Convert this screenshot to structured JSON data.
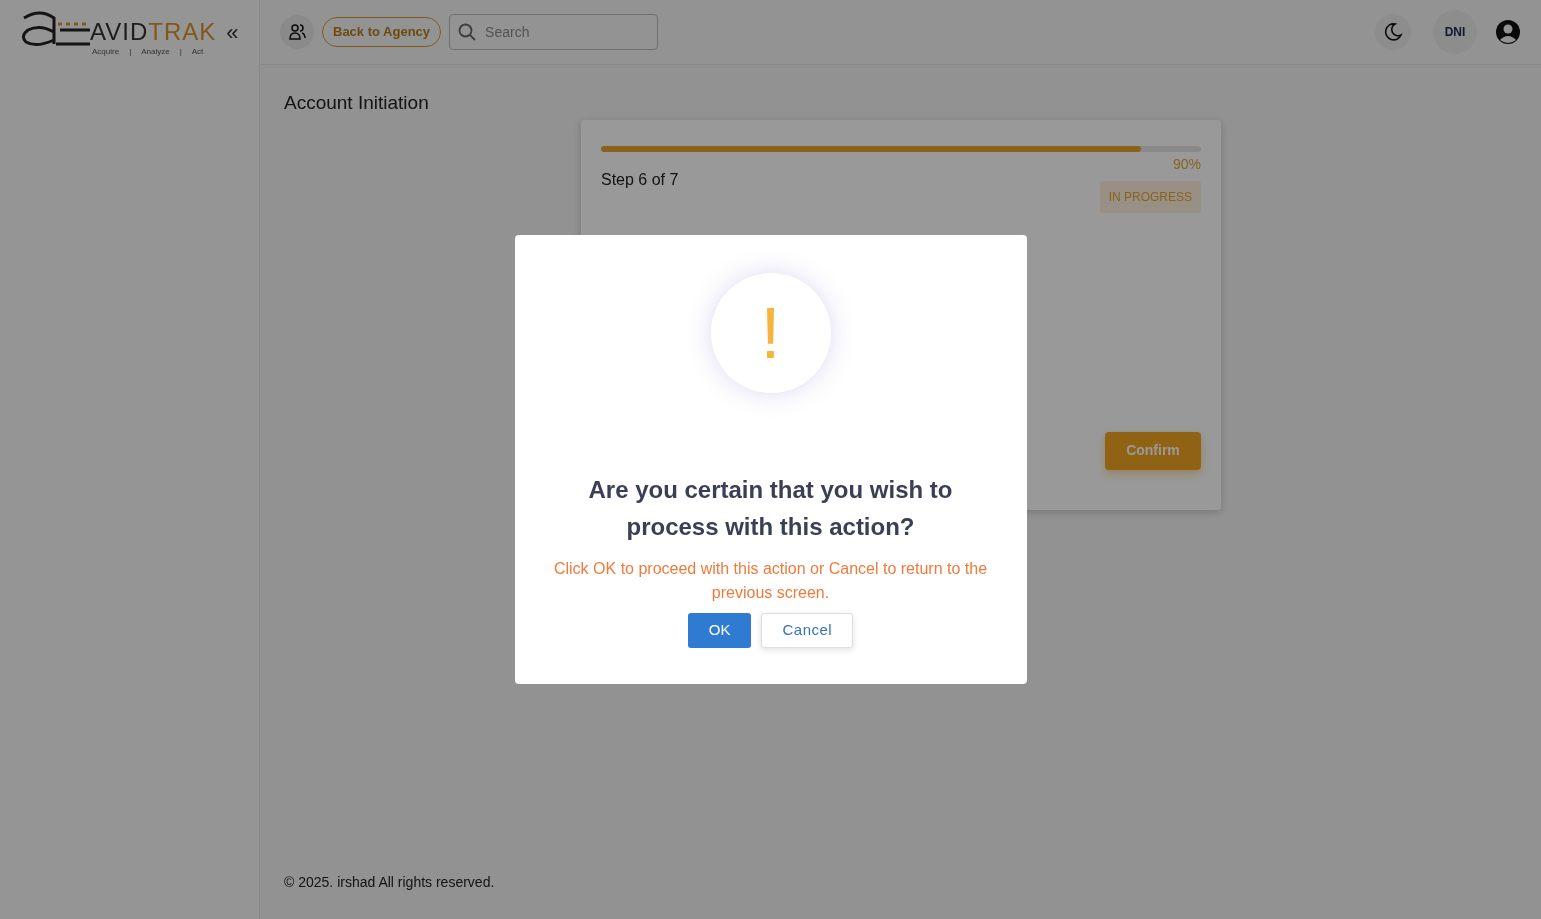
{
  "logo": {
    "primary": "AVID",
    "accent": "TRAK",
    "taglines": [
      "Acquire",
      "|",
      "Analyze",
      "|",
      "Act"
    ]
  },
  "header": {
    "collapse_glyph": "«",
    "back_button": "Back to Agency",
    "search": {
      "placeholder": "Search"
    },
    "avatar": "DNI"
  },
  "page_title": "Account Initiation",
  "wizard": {
    "level": 0.9,
    "percent": "90%",
    "step": "Step 6 of 7",
    "status": "IN PROGRESS",
    "confirm_button": "Confirm"
  },
  "dialog": {
    "icon_glyph": "!",
    "title": "Are you certain that you wish to process with this action?",
    "message": "Click OK to proceed with this action or Cancel to return to the previous screen.",
    "buttons": [
      {
        "label": "OK",
        "kind": "primary"
      },
      {
        "label": "Cancel",
        "kind": "secondary"
      }
    ]
  },
  "footer": "© 2025. irshad All rights reserved."
}
